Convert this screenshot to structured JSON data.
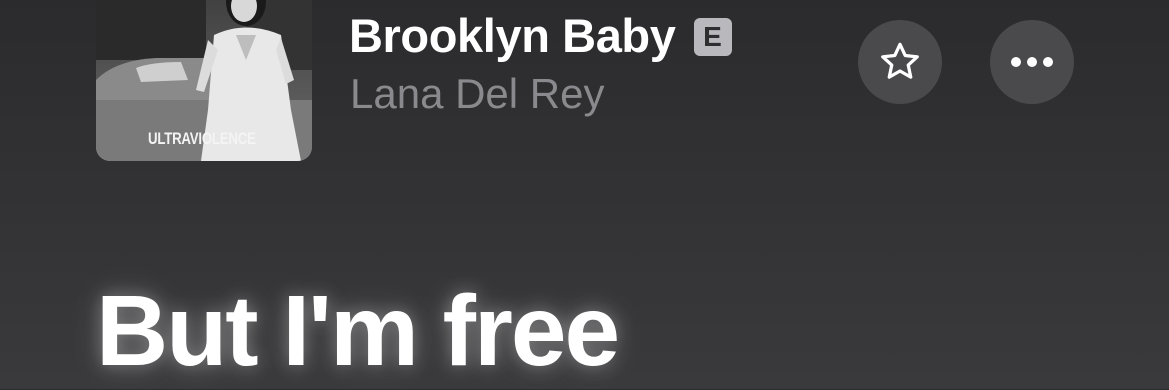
{
  "now_playing": {
    "album_art": {
      "album_title": "ULTRAVIOLENCE",
      "icon": "album-cover-image"
    },
    "track_title": "Brooklyn Baby",
    "explicit_badge": "E",
    "artist": "Lana Del Rey",
    "favorite_button": {
      "icon": "star-outline-icon"
    },
    "more_button": {
      "icon": "ellipsis-icon"
    }
  },
  "lyrics": {
    "current_line": "But I'm free"
  },
  "colors": {
    "background": "#2e2e30",
    "primary_text": "#ffffff",
    "secondary_text": "#8a8a8e",
    "button_bg": "#4a4a4c",
    "badge_bg": "#b9b9bd"
  }
}
